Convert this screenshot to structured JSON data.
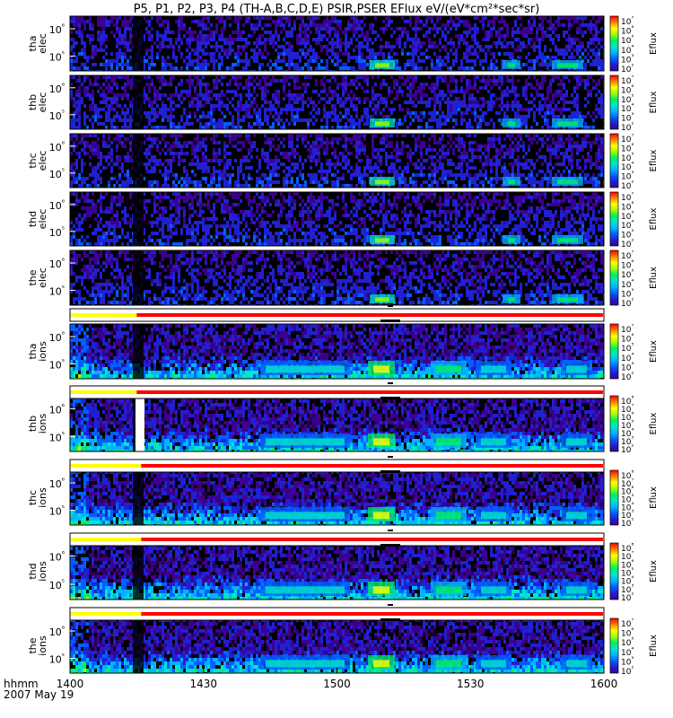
{
  "title": "P5, P1, P2, P3, P4 (TH-A,B,C,D,E) PSIR,PSER EFlux eV/(eV*cm²*sec*sr)",
  "footer": {
    "time_label": "hhmm",
    "date_label": "2007 May 19"
  },
  "colors": {
    "bar_yellow": "#ffff00",
    "bar_red": "#ff0000",
    "spectrogram_palette": [
      "#000000",
      "#2a0050",
      "#3c0090",
      "#2020d0",
      "#0060ff",
      "#00b4ff",
      "#00e6c8",
      "#00f060",
      "#a0ff00",
      "#ffff00",
      "#ff8000",
      "#ff0000"
    ]
  },
  "chart_data": {
    "type": "heatmap",
    "x_axis": {
      "ticks": [
        "1400",
        "1430",
        "1500",
        "1530",
        "1600"
      ],
      "range_hhmm": [
        "1400",
        "1600"
      ],
      "label": "hhmm"
    },
    "colorbar_label": "Eflux",
    "panels": [
      {
        "probe": "tha",
        "species": "elec",
        "y_ticks": [
          "10⁵",
          "10⁶"
        ],
        "cbar_ticks": [
          "10²",
          "10³",
          "10⁴",
          "10⁵",
          "10⁶",
          "10⁷"
        ]
      },
      {
        "probe": "thb",
        "species": "elec",
        "y_ticks": [
          "10⁵",
          "10⁶"
        ],
        "cbar_ticks": [
          "10²",
          "10³",
          "10⁴",
          "10⁵",
          "10⁶",
          "10⁷"
        ]
      },
      {
        "probe": "thc",
        "species": "elec",
        "y_ticks": [
          "10⁵",
          "10⁶"
        ],
        "cbar_ticks": [
          "10²",
          "10³",
          "10⁴",
          "10⁵",
          "10⁶",
          "10⁷"
        ]
      },
      {
        "probe": "thd",
        "species": "elec",
        "y_ticks": [
          "10⁵",
          "10⁶"
        ],
        "cbar_ticks": [
          "10²",
          "10³",
          "10⁴",
          "10⁵",
          "10⁶",
          "10⁷"
        ]
      },
      {
        "probe": "the",
        "species": "elec",
        "y_ticks": [
          "10⁵",
          "10⁶"
        ],
        "cbar_ticks": [
          "10²",
          "10³",
          "10⁴",
          "10⁵",
          "10⁶",
          "10⁷"
        ]
      },
      {
        "probe": "tha",
        "species": "ions",
        "y_ticks": [
          "10⁵",
          "10⁶"
        ],
        "cbar_ticks": [
          "10²",
          "10³",
          "10⁴",
          "10⁵",
          "10⁶",
          "10⁷"
        ]
      },
      {
        "probe": "thb",
        "species": "ions",
        "y_ticks": [
          "10⁵",
          "10⁶"
        ],
        "cbar_ticks": [
          "10²",
          "10³",
          "10⁴",
          "10⁵",
          "10⁶",
          "10⁷",
          "10⁸"
        ]
      },
      {
        "probe": "thc",
        "species": "ions",
        "y_ticks": [
          "10⁵",
          "10⁶"
        ],
        "cbar_ticks": [
          "10²",
          "10³",
          "10⁴",
          "10⁵",
          "10⁶",
          "10⁷",
          "10⁸"
        ]
      },
      {
        "probe": "thd",
        "species": "ions",
        "y_ticks": [
          "10⁵",
          "10⁶"
        ],
        "cbar_ticks": [
          "10²",
          "10³",
          "10⁴",
          "10⁵",
          "10⁶",
          "10⁷",
          "10⁸"
        ]
      },
      {
        "probe": "the",
        "species": "ions",
        "y_ticks": [
          "10⁵",
          "10⁶"
        ],
        "cbar_ticks": [
          "10²",
          "10³",
          "10⁴",
          "10⁵",
          "10⁶",
          "10⁷"
        ]
      }
    ],
    "mode_bars": [
      {
        "after_panel": "the elec",
        "yellow_until": "1415",
        "red_until": "1600"
      },
      {
        "after_panel": "tha ions",
        "yellow_until": "1415",
        "red_until": "1600"
      },
      {
        "after_panel": "thb ions",
        "yellow_until": "1416",
        "red_until": "1600"
      },
      {
        "after_panel": "thc ions",
        "yellow_until": "1416",
        "red_until": "1600"
      },
      {
        "after_panel": "thd ions",
        "yellow_until": "1416",
        "red_until": "1600"
      }
    ]
  }
}
